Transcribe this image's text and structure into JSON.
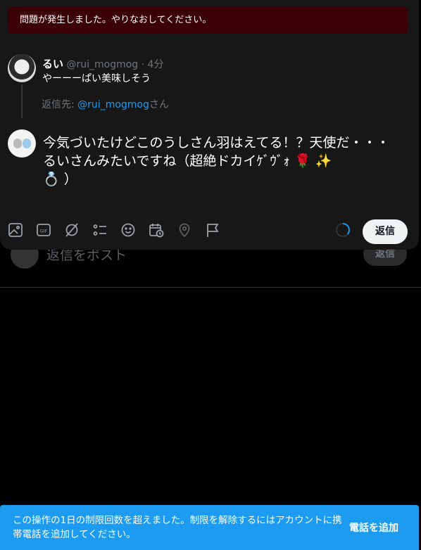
{
  "error_banner": "問題が発生しました。やりなおしてください。",
  "original_post": {
    "name": "るい",
    "handle": "@rui_mogmog",
    "separator": "·",
    "time": "4分",
    "text": "やーーーぱい美味しそう"
  },
  "replying_to": {
    "prefix": "返信先: ",
    "mention": "@rui_mogmog",
    "suffix": "さん"
  },
  "compose": {
    "text_main": "今気づいたけどこのうしさん羽はえてる！？天使だ・・・るいさんみたいですね（超絶ドカイｹﾞｳﾞｫ",
    "emoji_rose": "🌹",
    "emoji_sparkles": "✨",
    "emoji_ring": "💍",
    "text_end": "）"
  },
  "toolbar": {
    "icons": [
      "image-icon",
      "gif-icon",
      "grok-icon",
      "poll-icon",
      "emoji-icon",
      "schedule-icon",
      "location-icon",
      "flag-icon"
    ],
    "reply_label": "返信"
  },
  "background_reply": {
    "placeholder": "返信をポスト",
    "button_label": "返信"
  },
  "toast": {
    "message": "この操作の1日の制限回数を超えました。制限を解除するにはアカウントに携帯電話を追加してください。",
    "action": "電話を追加"
  },
  "colors": {
    "accent": "#1d9bf0",
    "error_bg": "#3a0005",
    "modal_bg": "#171717"
  }
}
